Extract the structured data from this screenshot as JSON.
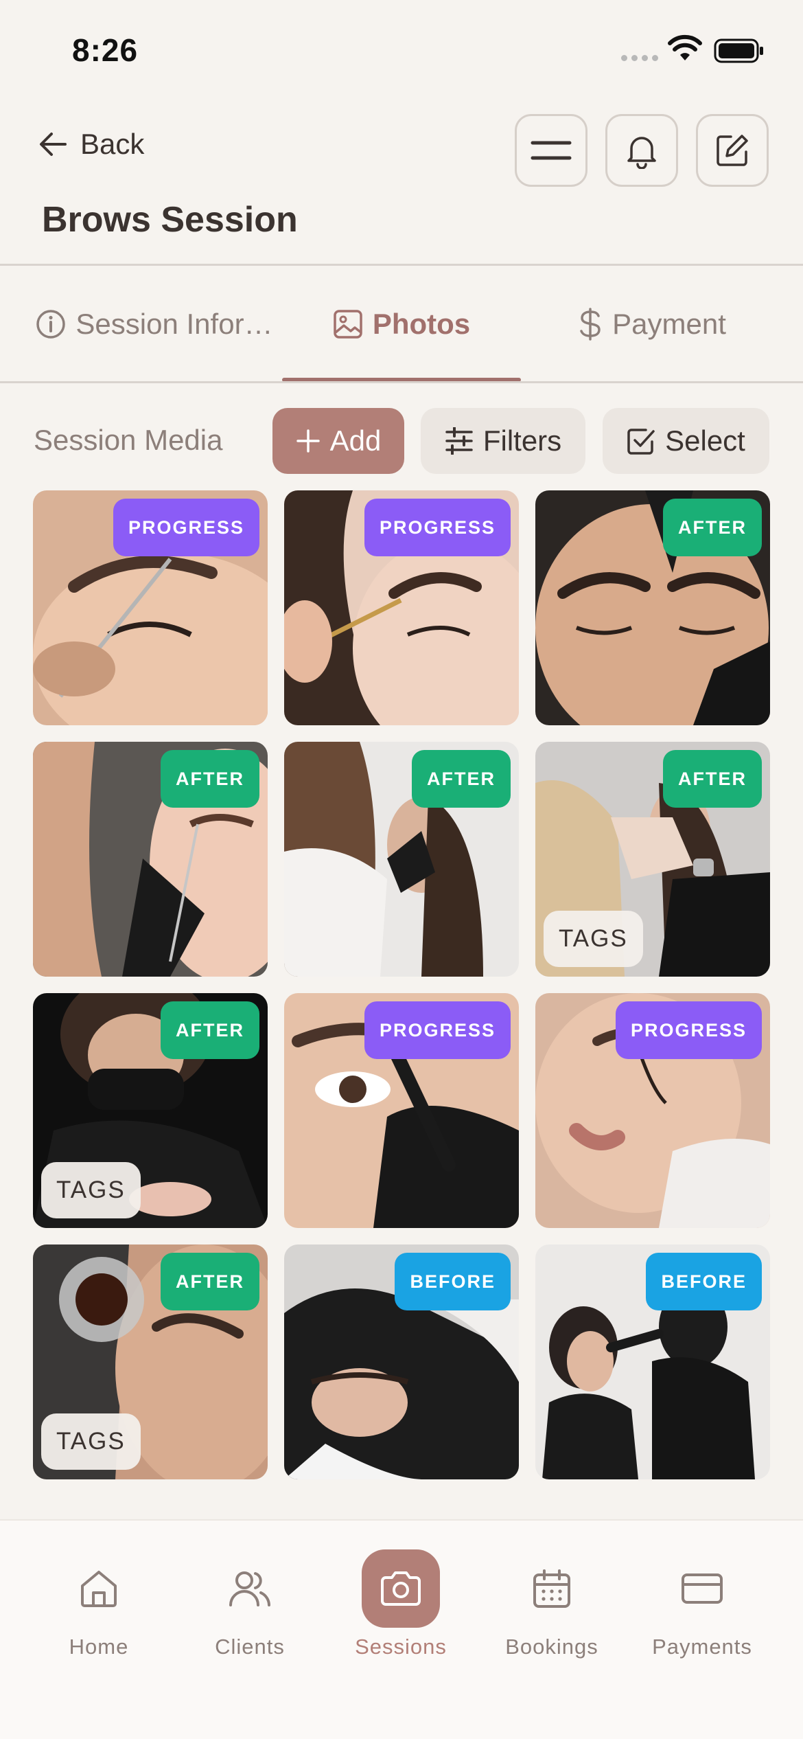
{
  "status_bar": {
    "time": "8:26"
  },
  "header": {
    "back_label": "Back",
    "title": "Brows Session",
    "actions": [
      "menu-icon",
      "bell-icon",
      "edit-icon"
    ]
  },
  "tabs": [
    {
      "label": "Session Infor…",
      "icon": "info-icon",
      "active": false
    },
    {
      "label": "Photos",
      "icon": "image-icon",
      "active": true
    },
    {
      "label": "Payment",
      "icon": "dollar-icon",
      "active": false
    }
  ],
  "media": {
    "title": "Session Media",
    "add_label": "Add",
    "filters_label": "Filters",
    "select_label": "Select",
    "tags_label": "TAGS",
    "photos": [
      {
        "badge": "PROGRESS",
        "tags": false
      },
      {
        "badge": "PROGRESS",
        "tags": false
      },
      {
        "badge": "AFTER",
        "tags": false
      },
      {
        "badge": "AFTER",
        "tags": false
      },
      {
        "badge": "AFTER",
        "tags": false
      },
      {
        "badge": "AFTER",
        "tags": true
      },
      {
        "badge": "AFTER",
        "tags": true
      },
      {
        "badge": "PROGRESS",
        "tags": false
      },
      {
        "badge": "PROGRESS",
        "tags": false
      },
      {
        "badge": "AFTER",
        "tags": true
      },
      {
        "badge": "BEFORE",
        "tags": false
      },
      {
        "badge": "BEFORE",
        "tags": false
      }
    ]
  },
  "badge_colors": {
    "PROGRESS": "#8b5cf6",
    "AFTER": "#1aaf76",
    "BEFORE": "#1aa3e3"
  },
  "accent_color": "#b27f77",
  "nav": [
    {
      "label": "Home",
      "icon": "home-icon",
      "active": false
    },
    {
      "label": "Clients",
      "icon": "users-icon",
      "active": false
    },
    {
      "label": "Sessions",
      "icon": "camera-icon",
      "active": true
    },
    {
      "label": "Bookings",
      "icon": "calendar-icon",
      "active": false
    },
    {
      "label": "Payments",
      "icon": "card-icon",
      "active": false
    }
  ]
}
